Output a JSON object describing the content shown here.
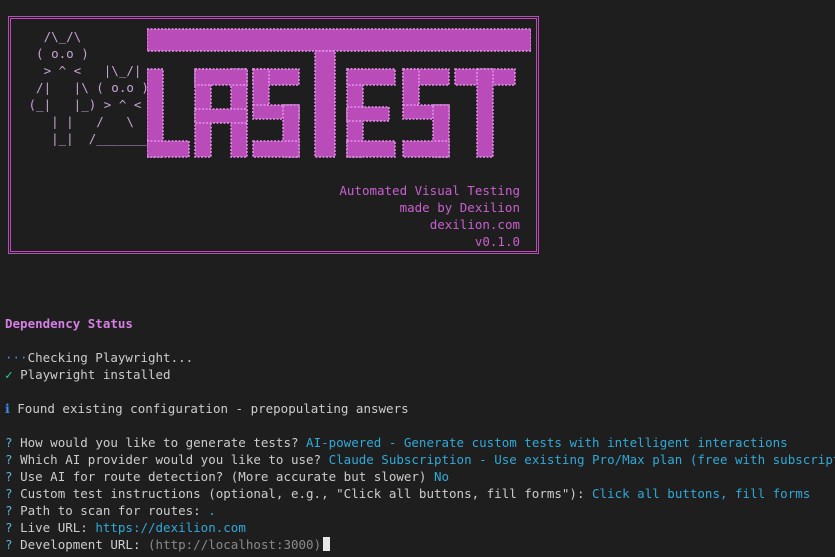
{
  "banner": {
    "ascii_art": "   /\\_/\\\n  ( o.o )\n   > ^ <   |\\_/|\n  /|   |\\ ( o.o )\n (_|   |_) > ^ <\n    | |   /   \\\n    |_|  /_______\\",
    "logo_text": "LASTEST",
    "tagline": [
      "Automated Visual Testing",
      "made by Dexilion",
      "dexilion.com",
      "v0.1.0"
    ]
  },
  "dependency": {
    "heading": "Dependency Status",
    "checking_icon": "···",
    "checking_text": "Checking Playwright...",
    "check_icon": "✓",
    "installed_text": "Playwright installed"
  },
  "config": {
    "info_icon": "ℹ",
    "text": "Found existing configuration - prepopulating answers"
  },
  "prompts": [
    {
      "q": "How would you like to generate tests?",
      "a": "AI-powered - Generate custom tests with intelligent interactions"
    },
    {
      "q": "Which AI provider would you like to use?",
      "a": "Claude Subscription - Use existing Pro/Max plan (free with subscription)"
    },
    {
      "q": "Use AI for route detection? (More accurate but slower)",
      "a": "No"
    },
    {
      "q": "Custom test instructions (optional, e.g., \"Click all buttons, fill forms\"):",
      "a": "Click all buttons, fill forms"
    },
    {
      "q": "Path to scan for routes:",
      "a": "."
    },
    {
      "q": "Live URL:",
      "a": "https://dexilion.com"
    },
    {
      "q": "Development URL:",
      "a": "(http://localhost:3000)"
    }
  ],
  "prompt_marker": "?",
  "colors": {
    "background": "#1e1e1e",
    "banner_border": "#b94cb9",
    "logo": "#b94cb9",
    "heading": "#d67ee5",
    "answer": "#2fa9d8",
    "success": "#23d18b",
    "info": "#3b8eea"
  }
}
